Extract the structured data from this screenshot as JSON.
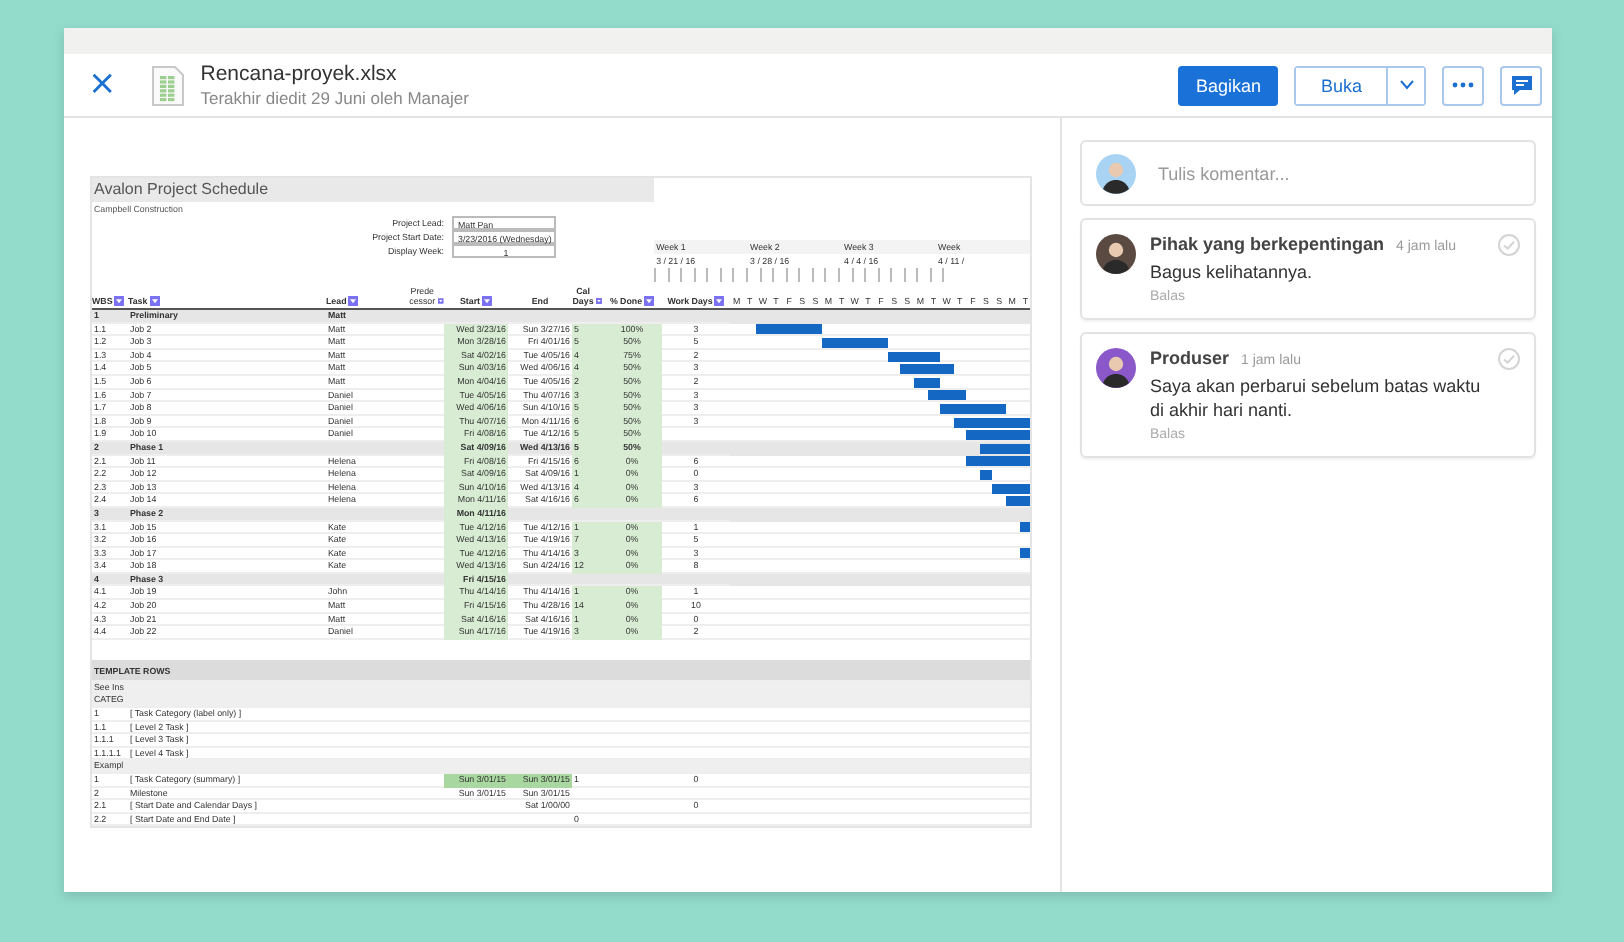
{
  "header": {
    "close": "×",
    "file_name": "Rencana-proyek.xlsx",
    "subtitle": "Terakhir diedit 29 Juni oleh Manajer",
    "buttons": {
      "share": "Bagikan",
      "open": "Buka"
    }
  },
  "sheet": {
    "title": "Avalon Project Schedule",
    "subtitle": "Campbell Construction",
    "info": [
      {
        "label": "Project Lead:",
        "value": "Matt Pan"
      },
      {
        "label": "Project Start Date:",
        "value": "3/23/2016 (Wednesday)"
      },
      {
        "label": "Display Week:",
        "value": "1"
      }
    ],
    "weeks": [
      {
        "label": "Week 1",
        "date": "3 / 21 / 16"
      },
      {
        "label": "Week 2",
        "date": "3 / 28 / 16"
      },
      {
        "label": "Week 3",
        "date": "4 / 4 / 16"
      },
      {
        "label": "Week",
        "date": "4 / 11 /"
      }
    ],
    "days": [
      "M",
      "T",
      "W",
      "T",
      "F",
      "S",
      "S",
      "M",
      "T",
      "W",
      "T",
      "F",
      "S",
      "S",
      "M",
      "T",
      "W",
      "T",
      "F",
      "S",
      "S",
      "M",
      "T"
    ],
    "columns": [
      {
        "label": "WBS",
        "filter": true
      },
      {
        "label": "Task",
        "filter": true
      },
      {
        "label": "Lead",
        "filter": true
      },
      {
        "label": "Prede cessor",
        "filter": true
      },
      {
        "label": "Start",
        "filter": true
      },
      {
        "label": "End",
        "filter": false
      },
      {
        "label": "Cal Days",
        "filter": true
      },
      {
        "label": "% Done",
        "filter": true
      },
      {
        "label": "Work Days",
        "filter": true
      }
    ],
    "rows": [
      {
        "kind": "phase",
        "wbs": "1",
        "task": "Preliminary",
        "lead": "Matt"
      },
      {
        "kind": "task",
        "wbs": "1.1",
        "task": "Job 2",
        "lead": "Matt",
        "start": "Wed 3/23/16",
        "end": "Sun 3/27/16",
        "cal_days": "5",
        "done": "100%",
        "work_days": "3"
      },
      {
        "kind": "task",
        "wbs": "1.2",
        "task": "Job 3",
        "lead": "Matt",
        "start": "Mon 3/28/16",
        "end": "Fri 4/01/16",
        "cal_days": "5",
        "done": "50%",
        "work_days": "5"
      },
      {
        "kind": "task",
        "wbs": "1.3",
        "task": "Job 4",
        "lead": "Matt",
        "start": "Sat 4/02/16",
        "end": "Tue 4/05/16",
        "cal_days": "4",
        "done": "75%",
        "work_days": "2"
      },
      {
        "kind": "task",
        "wbs": "1.4",
        "task": "Job 5",
        "lead": "Matt",
        "start": "Sun 4/03/16",
        "end": "Wed 4/06/16",
        "cal_days": "4",
        "done": "50%",
        "work_days": "3"
      },
      {
        "kind": "task",
        "wbs": "1.5",
        "task": "Job 6",
        "lead": "Matt",
        "start": "Mon 4/04/16",
        "end": "Tue 4/05/16",
        "cal_days": "2",
        "done": "50%",
        "work_days": "2"
      },
      {
        "kind": "task",
        "wbs": "1.6",
        "task": "Job 7",
        "lead": "Daniel",
        "start": "Tue 4/05/16",
        "end": "Thu 4/07/16",
        "cal_days": "3",
        "done": "50%",
        "work_days": "3"
      },
      {
        "kind": "task",
        "wbs": "1.7",
        "task": "Job 8",
        "lead": "Daniel",
        "start": "Wed 4/06/16",
        "end": "Sun 4/10/16",
        "cal_days": "5",
        "done": "50%",
        "work_days": "3"
      },
      {
        "kind": "task",
        "wbs": "1.8",
        "task": "Job 9",
        "lead": "Daniel",
        "start": "Thu 4/07/16",
        "end": "Mon 4/11/16",
        "cal_days": "6",
        "done": "50%",
        "work_days": "3"
      },
      {
        "kind": "task",
        "wbs": "1.9",
        "task": "Job 10",
        "lead": "Daniel",
        "start": "Fri 4/08/16",
        "end": "Tue 4/12/16",
        "cal_days": "5",
        "done": "50%"
      },
      {
        "kind": "phase",
        "wbs": "2",
        "task": "Phase 1",
        "start": "Sat 4/09/16",
        "end": "Wed 4/13/16",
        "cal_days": "5",
        "done": "50%"
      },
      {
        "kind": "task",
        "wbs": "2.1",
        "task": "Job 11",
        "lead": "Helena",
        "start": "Fri 4/08/16",
        "end": "Fri 4/15/16",
        "cal_days": "6",
        "done": "0%",
        "work_days": "6"
      },
      {
        "kind": "task",
        "wbs": "2.2",
        "task": "Job 12",
        "lead": "Helena",
        "start": "Sat 4/09/16",
        "end": "Sat 4/09/16",
        "cal_days": "1",
        "done": "0%",
        "work_days": "0"
      },
      {
        "kind": "task",
        "wbs": "2.3",
        "task": "Job 13",
        "lead": "Helena",
        "start": "Sun 4/10/16",
        "end": "Wed 4/13/16",
        "cal_days": "4",
        "done": "0%",
        "work_days": "3"
      },
      {
        "kind": "task",
        "wbs": "2.4",
        "task": "Job 14",
        "lead": "Helena",
        "start": "Mon 4/11/16",
        "end": "Sat 4/16/16",
        "cal_days": "6",
        "done": "0%",
        "work_days": "6"
      },
      {
        "kind": "phase",
        "wbs": "3",
        "task": "Phase 2",
        "start": "Mon 4/11/16"
      },
      {
        "kind": "task",
        "wbs": "3.1",
        "task": "Job 15",
        "lead": "Kate",
        "start": "Tue 4/12/16",
        "end": "Tue 4/12/16",
        "cal_days": "1",
        "done": "0%",
        "work_days": "1"
      },
      {
        "kind": "task",
        "wbs": "3.2",
        "task": "Job 16",
        "lead": "Kate",
        "start": "Wed 4/13/16",
        "end": "Tue 4/19/16",
        "cal_days": "7",
        "done": "0%",
        "work_days": "5"
      },
      {
        "kind": "task",
        "wbs": "3.3",
        "task": "Job 17",
        "lead": "Kate",
        "start": "Tue 4/12/16",
        "end": "Thu 4/14/16",
        "cal_days": "3",
        "done": "0%",
        "work_days": "3"
      },
      {
        "kind": "task",
        "wbs": "3.4",
        "task": "Job 18",
        "lead": "Kate",
        "start": "Wed 4/13/16",
        "end": "Sun 4/24/16",
        "cal_days": "12",
        "done": "0%",
        "work_days": "8"
      },
      {
        "kind": "phase",
        "wbs": "4",
        "task": "Phase 3",
        "start": "Fri 4/15/16"
      },
      {
        "kind": "task",
        "wbs": "4.1",
        "task": "Job 19",
        "lead": "John",
        "start": "Thu 4/14/16",
        "end": "Thu 4/14/16",
        "cal_days": "1",
        "done": "0%",
        "work_days": "1"
      },
      {
        "kind": "task",
        "wbs": "4.2",
        "task": "Job 20",
        "lead": "Matt",
        "start": "Fri 4/15/16",
        "end": "Thu 4/28/16",
        "cal_days": "14",
        "done": "0%",
        "work_days": "10"
      },
      {
        "kind": "task",
        "wbs": "4.3",
        "task": "Job 21",
        "lead": "Matt",
        "start": "Sat 4/16/16",
        "end": "Sat 4/16/16",
        "cal_days": "1",
        "done": "0%",
        "work_days": "0"
      },
      {
        "kind": "task",
        "wbs": "4.4",
        "task": "Job 22",
        "lead": "Daniel",
        "start": "Sun 4/17/16",
        "end": "Tue 4/19/16",
        "cal_days": "3",
        "done": "0%",
        "work_days": "2"
      }
    ],
    "template_rows": [
      {
        "kind": "header",
        "wbs": "TEMPLATE ROWS"
      },
      {
        "kind": "note",
        "wbs": "See Ins"
      },
      {
        "kind": "note",
        "wbs": "CATEG"
      },
      {
        "kind": "template",
        "wbs": "1",
        "task": "[ Task Category (label only) ]"
      },
      {
        "kind": "template",
        "wbs": "1.1",
        "task": "[ Level 2 Task ]"
      },
      {
        "kind": "template",
        "wbs": "1.1.1",
        "task": "[ Level 3 Task ]"
      },
      {
        "kind": "template",
        "wbs": "1.1.1.1",
        "task": "[ Level 4 Task ]"
      },
      {
        "kind": "note",
        "wbs": "Exampl"
      },
      {
        "kind": "summary",
        "wbs": "1",
        "task": "[ Task Category (summary) ]",
        "start": "Sun 3/01/15",
        "end": "Sun 3/01/15",
        "cal_days": "1",
        "work_days": "0"
      },
      {
        "kind": "template",
        "wbs": "2",
        "task": "Milestone",
        "start": "Sun 3/01/15",
        "end": "Sun 3/01/15"
      },
      {
        "kind": "dated",
        "wbs": "2.1",
        "task": "[ Start Date and Calendar Days ]",
        "end": "Sat 1/00/00",
        "work_days": "0"
      },
      {
        "kind": "dated",
        "wbs": "2.2",
        "task": "[ Start Date and End Date ]",
        "cal_days": "0"
      }
    ]
  },
  "comments": {
    "placeholder": "Tulis komentar...",
    "items": [
      {
        "author": "Pihak yang berkepentingan",
        "time": "4 jam lalu",
        "text": "Bagus kelihatannya.",
        "reply": "Balas"
      },
      {
        "author": "Produser",
        "time": "1 jam lalu",
        "text": "Saya akan perbarui sebelum batas waktu di akhir hari nanti.",
        "reply": "Balas"
      }
    ]
  }
}
